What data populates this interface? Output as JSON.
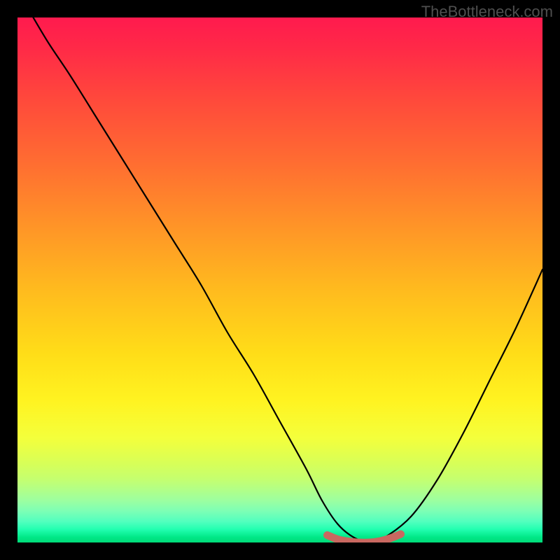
{
  "watermark": "TheBottleneck.com",
  "colors": {
    "gradient_stops": [
      {
        "offset": 0.0,
        "color": "#ff1a4e"
      },
      {
        "offset": 0.06,
        "color": "#ff2a47"
      },
      {
        "offset": 0.16,
        "color": "#ff4a3b"
      },
      {
        "offset": 0.28,
        "color": "#ff6e31"
      },
      {
        "offset": 0.4,
        "color": "#ff9527"
      },
      {
        "offset": 0.52,
        "color": "#ffbb1e"
      },
      {
        "offset": 0.64,
        "color": "#ffdd18"
      },
      {
        "offset": 0.73,
        "color": "#fff321"
      },
      {
        "offset": 0.8,
        "color": "#f4ff3b"
      },
      {
        "offset": 0.85,
        "color": "#d7ff58"
      },
      {
        "offset": 0.88,
        "color": "#c4ff70"
      },
      {
        "offset": 0.9,
        "color": "#b1ff88"
      },
      {
        "offset": 0.92,
        "color": "#9cffa0"
      },
      {
        "offset": 0.94,
        "color": "#7dffb5"
      },
      {
        "offset": 0.96,
        "color": "#52ffbe"
      },
      {
        "offset": 0.975,
        "color": "#22ffb0"
      },
      {
        "offset": 0.99,
        "color": "#00e887"
      },
      {
        "offset": 1.0,
        "color": "#00db78"
      }
    ],
    "curve": "#000000",
    "marker": "#c96860"
  },
  "chart_data": {
    "type": "line",
    "title": "",
    "xlabel": "",
    "ylabel": "",
    "xlim": [
      0,
      100
    ],
    "ylim": [
      0,
      100
    ],
    "grid": "off",
    "series": [
      {
        "name": "bottleneck-curve",
        "x": [
          3,
          6,
          10,
          15,
          20,
          25,
          30,
          35,
          40,
          45,
          50,
          55,
          58,
          61,
          64,
          67,
          70,
          75,
          80,
          85,
          90,
          95,
          100
        ],
        "y": [
          100,
          95,
          89,
          81,
          73,
          65,
          57,
          49,
          40,
          32,
          23,
          14,
          8,
          3.5,
          1,
          0,
          1,
          5,
          12,
          21,
          31,
          41,
          52
        ]
      },
      {
        "name": "optimal-marker",
        "x": [
          59,
          61,
          63,
          65,
          67,
          69,
          71,
          73
        ],
        "y": [
          1.4,
          0.6,
          0.2,
          0.0,
          0.0,
          0.25,
          0.8,
          1.6
        ]
      }
    ],
    "optimal_range": [
      61,
      72
    ]
  }
}
